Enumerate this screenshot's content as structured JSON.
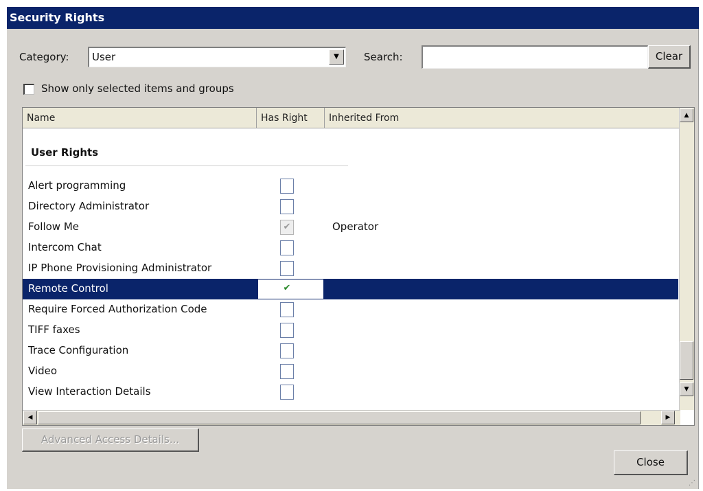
{
  "window": {
    "title": "Security Rights"
  },
  "filters": {
    "category_label": "Category:",
    "category_value": "User",
    "search_label": "Search:",
    "search_value": "",
    "clear_label": "Clear",
    "show_selected_label": "Show only selected items and groups",
    "show_selected_checked": false
  },
  "table": {
    "columns": [
      "Name",
      "Has Right",
      "Inherited From"
    ],
    "section_title": "User Rights",
    "rows": [
      {
        "name": "Alert programming",
        "has_right": false,
        "inherited_from": ""
      },
      {
        "name": "Directory Administrator",
        "has_right": false,
        "inherited_from": ""
      },
      {
        "name": "Follow Me",
        "has_right": true,
        "inherited": true,
        "inherited_from": "Operator"
      },
      {
        "name": "Intercom Chat",
        "has_right": false,
        "inherited_from": ""
      },
      {
        "name": "IP Phone Provisioning Administrator",
        "has_right": false,
        "inherited_from": ""
      },
      {
        "name": "Remote Control",
        "has_right": true,
        "selected": true,
        "inherited_from": ""
      },
      {
        "name": "Require Forced Authorization Code",
        "has_right": false,
        "inherited_from": ""
      },
      {
        "name": "TIFF faxes",
        "has_right": false,
        "inherited_from": ""
      },
      {
        "name": "Trace Configuration",
        "has_right": false,
        "inherited_from": ""
      },
      {
        "name": "Video",
        "has_right": false,
        "inherited_from": ""
      },
      {
        "name": "View Interaction Details",
        "has_right": false,
        "inherited_from": ""
      }
    ]
  },
  "buttons": {
    "advanced": "Advanced Access Details...",
    "close": "Close"
  },
  "colors": {
    "title_bar": "#0a246a",
    "selection": "#0a246a",
    "dialog_bg": "#d6d3ce"
  }
}
